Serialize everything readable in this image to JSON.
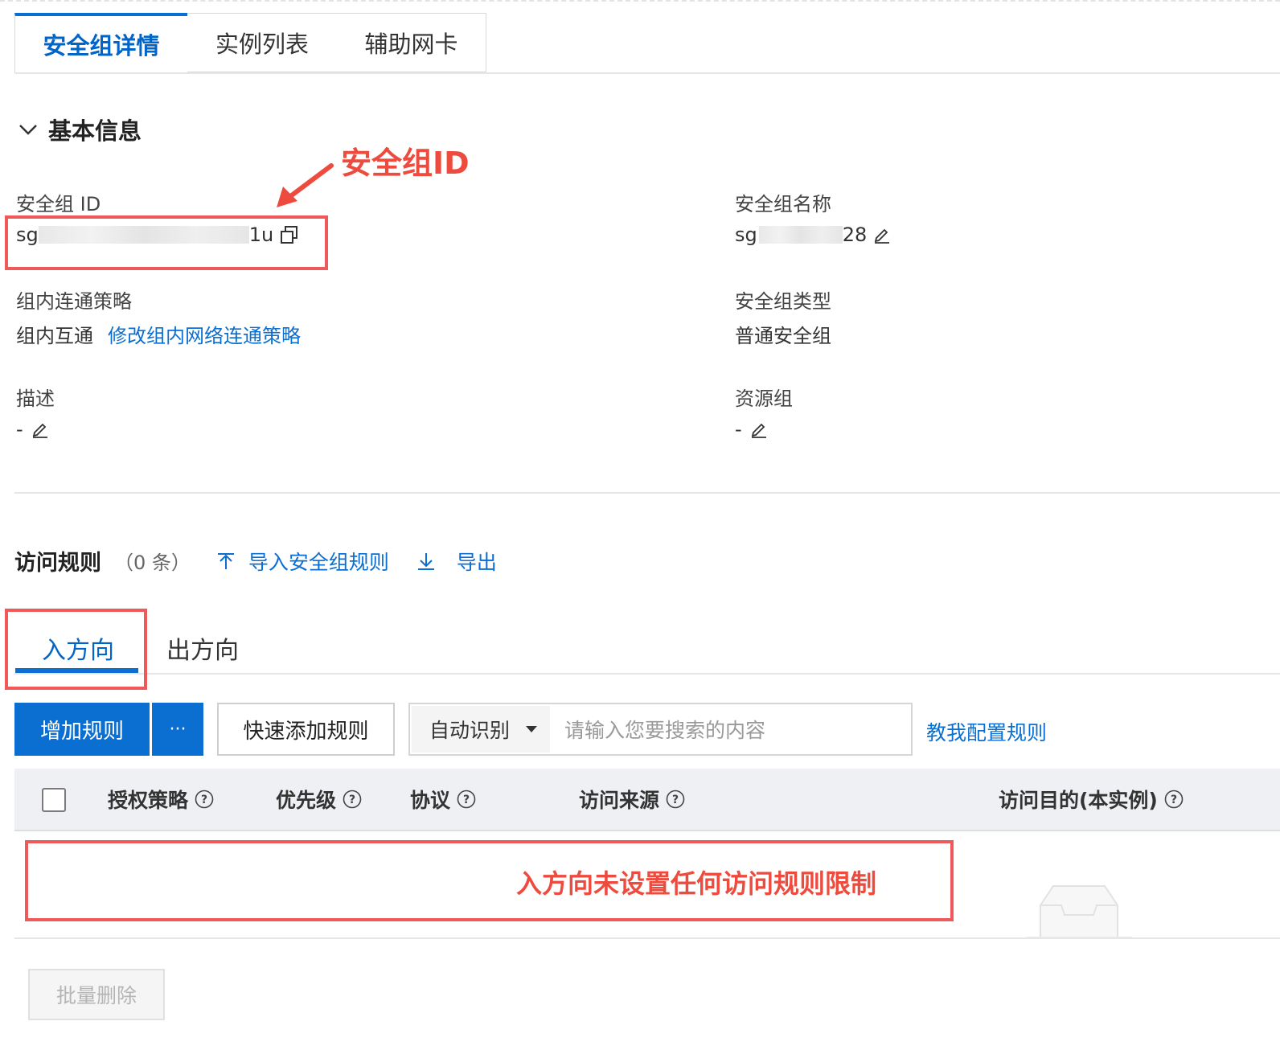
{
  "tabs": [
    {
      "label": "安全组详情",
      "active": true
    },
    {
      "label": "实例列表",
      "active": false
    },
    {
      "label": "辅助网卡",
      "active": false
    }
  ],
  "basic_info": {
    "title": "基本信息",
    "sg_id_label": "安全组 ID",
    "sg_id_prefix": "sg",
    "sg_id_suffix": "1u",
    "sg_name_label": "安全组名称",
    "sg_name_prefix": "sg",
    "sg_name_suffix": "28",
    "policy_label": "组内连通策略",
    "policy_value": "组内互通",
    "policy_link": "修改组内网络连通策略",
    "type_label": "安全组类型",
    "type_value": "普通安全组",
    "desc_label": "描述",
    "desc_value": "-",
    "rg_label": "资源组",
    "rg_value": "-"
  },
  "annotations": {
    "sg_id": "安全组ID",
    "empty_rules": "入方向未设置任何访问规则限制"
  },
  "rules": {
    "title": "访问规则",
    "count": "（0 条）",
    "import_label": "导入安全组规则",
    "export_label": "导出",
    "subtabs": [
      {
        "label": "入方向",
        "active": true
      },
      {
        "label": "出方向",
        "active": false
      }
    ],
    "add_label": "增加规则",
    "more_label": "···",
    "quick_add_label": "快速添加规则",
    "search_select": "自动识别",
    "search_placeholder": "请输入您要搜索的内容",
    "teach_label": "教我配置规则",
    "columns": [
      "授权策略",
      "优先级",
      "协议",
      "访问来源",
      "访问目的(本实例)"
    ],
    "batch_delete_label": "批量删除"
  },
  "colors": {
    "accent": "#0a6fd1",
    "annotation": "#ef5959"
  }
}
